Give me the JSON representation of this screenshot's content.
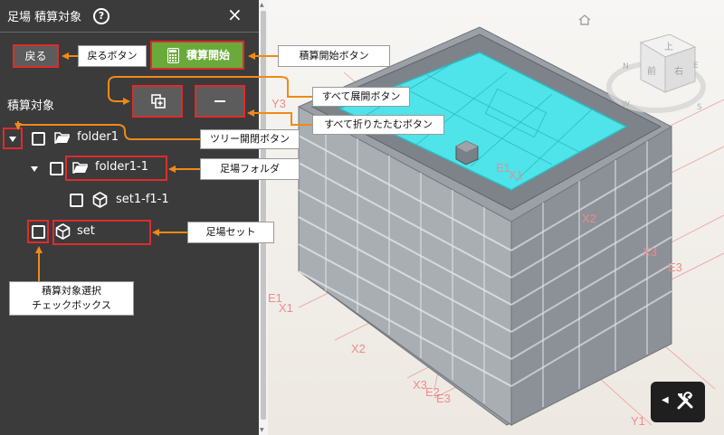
{
  "panel": {
    "title": "足場 積算対象",
    "help_icon": "?",
    "close_icon": "×",
    "back_label": "戻る",
    "start_label": "積算開始",
    "section_title": "積算対象",
    "tree": [
      {
        "label": "folder1"
      },
      {
        "label": "folder1-1"
      },
      {
        "label": "set1-f1-1"
      },
      {
        "label": "set"
      }
    ]
  },
  "callouts": {
    "back": "戻るボタン",
    "start": "積算開始ボタン",
    "expand_all": "すべて展開ボタン",
    "collapse_all": "すべて折りたたむボタン",
    "tree_toggle": "ツリー開閉ボタン",
    "scaffold_folder": "足場フォルダ",
    "scaffold_set": "足場セット",
    "checkbox_line1": "積算対象選択",
    "checkbox_line2": "チェックボックス"
  },
  "viewer": {
    "grid_labels": [
      "E1",
      "X1",
      "X2",
      "X3",
      "E3",
      "E1",
      "X1",
      "X2",
      "X3",
      "E2",
      "E3",
      "Y1",
      "Y3"
    ],
    "cube_labels": [
      "上",
      "前",
      "右"
    ],
    "compass_labels": [
      "N",
      "E",
      "S",
      "W"
    ]
  },
  "colors": {
    "panel_bg": "#3b3b3b",
    "start_green": "#6aaa3a",
    "highlight_red": "#e02b2b",
    "callout_arrow": "#f08a16",
    "grid_line": "#ef8b8b",
    "pool_cyan": "#4fe3ea",
    "scaffold": "#8e949a"
  }
}
